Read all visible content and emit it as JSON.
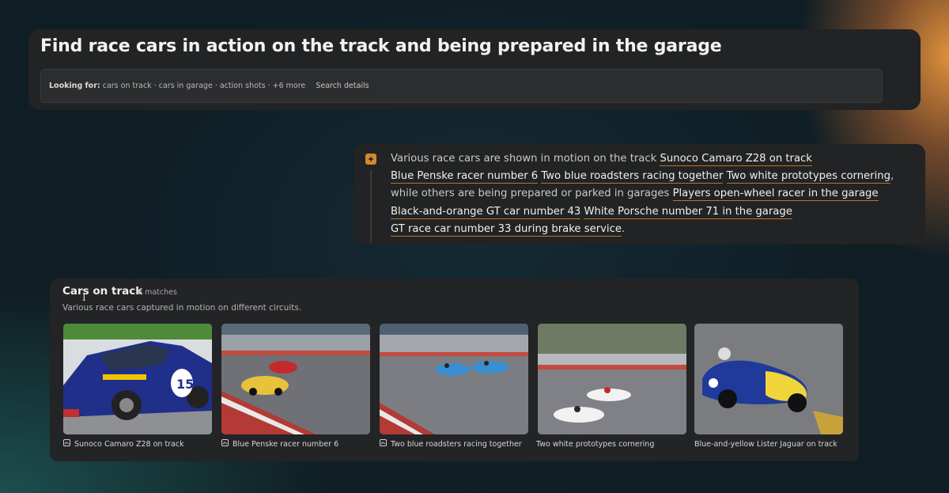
{
  "query": {
    "title": "Find race cars in action on the track and being prepared in the garage",
    "looking_for_label": "Looking for:",
    "looking_for_terms": "cars on track · cars in garage · action shots · +6 more",
    "search_details_label": "Search details"
  },
  "answer": {
    "icon": "sparkle-badge-icon",
    "intro": "Various race cars are shown in motion on the track",
    "citations": [
      "Sunoco Camaro Z28 on track",
      "Blue Penske racer number 6",
      "Two blue roadsters racing together",
      "Two white prototypes cornering",
      "Players open-wheel racer in the garage",
      "Black-and-orange GT car number 43",
      "White Porsche number 71 in the garage",
      "GT race car number 33 during brake service"
    ],
    "middle": ", while others are being prepared or parked in garages",
    "end": "."
  },
  "results": {
    "title": "Cars on track",
    "count": "6 matches",
    "description": "Various race cars captured in motion on different circuits.",
    "items": [
      {
        "caption": "Sunoco Camaro Z28 on track",
        "icon": "image-badge-icon"
      },
      {
        "caption": "Blue Penske racer number 6",
        "icon": "image-badge-icon"
      },
      {
        "caption": "Two blue roadsters racing together",
        "icon": "image-badge-icon"
      },
      {
        "caption": "Two white prototypes cornering",
        "icon": ""
      },
      {
        "caption": "Blue-and-yellow Lister Jaguar on track",
        "icon": ""
      }
    ]
  },
  "colors": {
    "accent": "#d08a2d",
    "card": "#222324",
    "background": "#0f1d24"
  }
}
